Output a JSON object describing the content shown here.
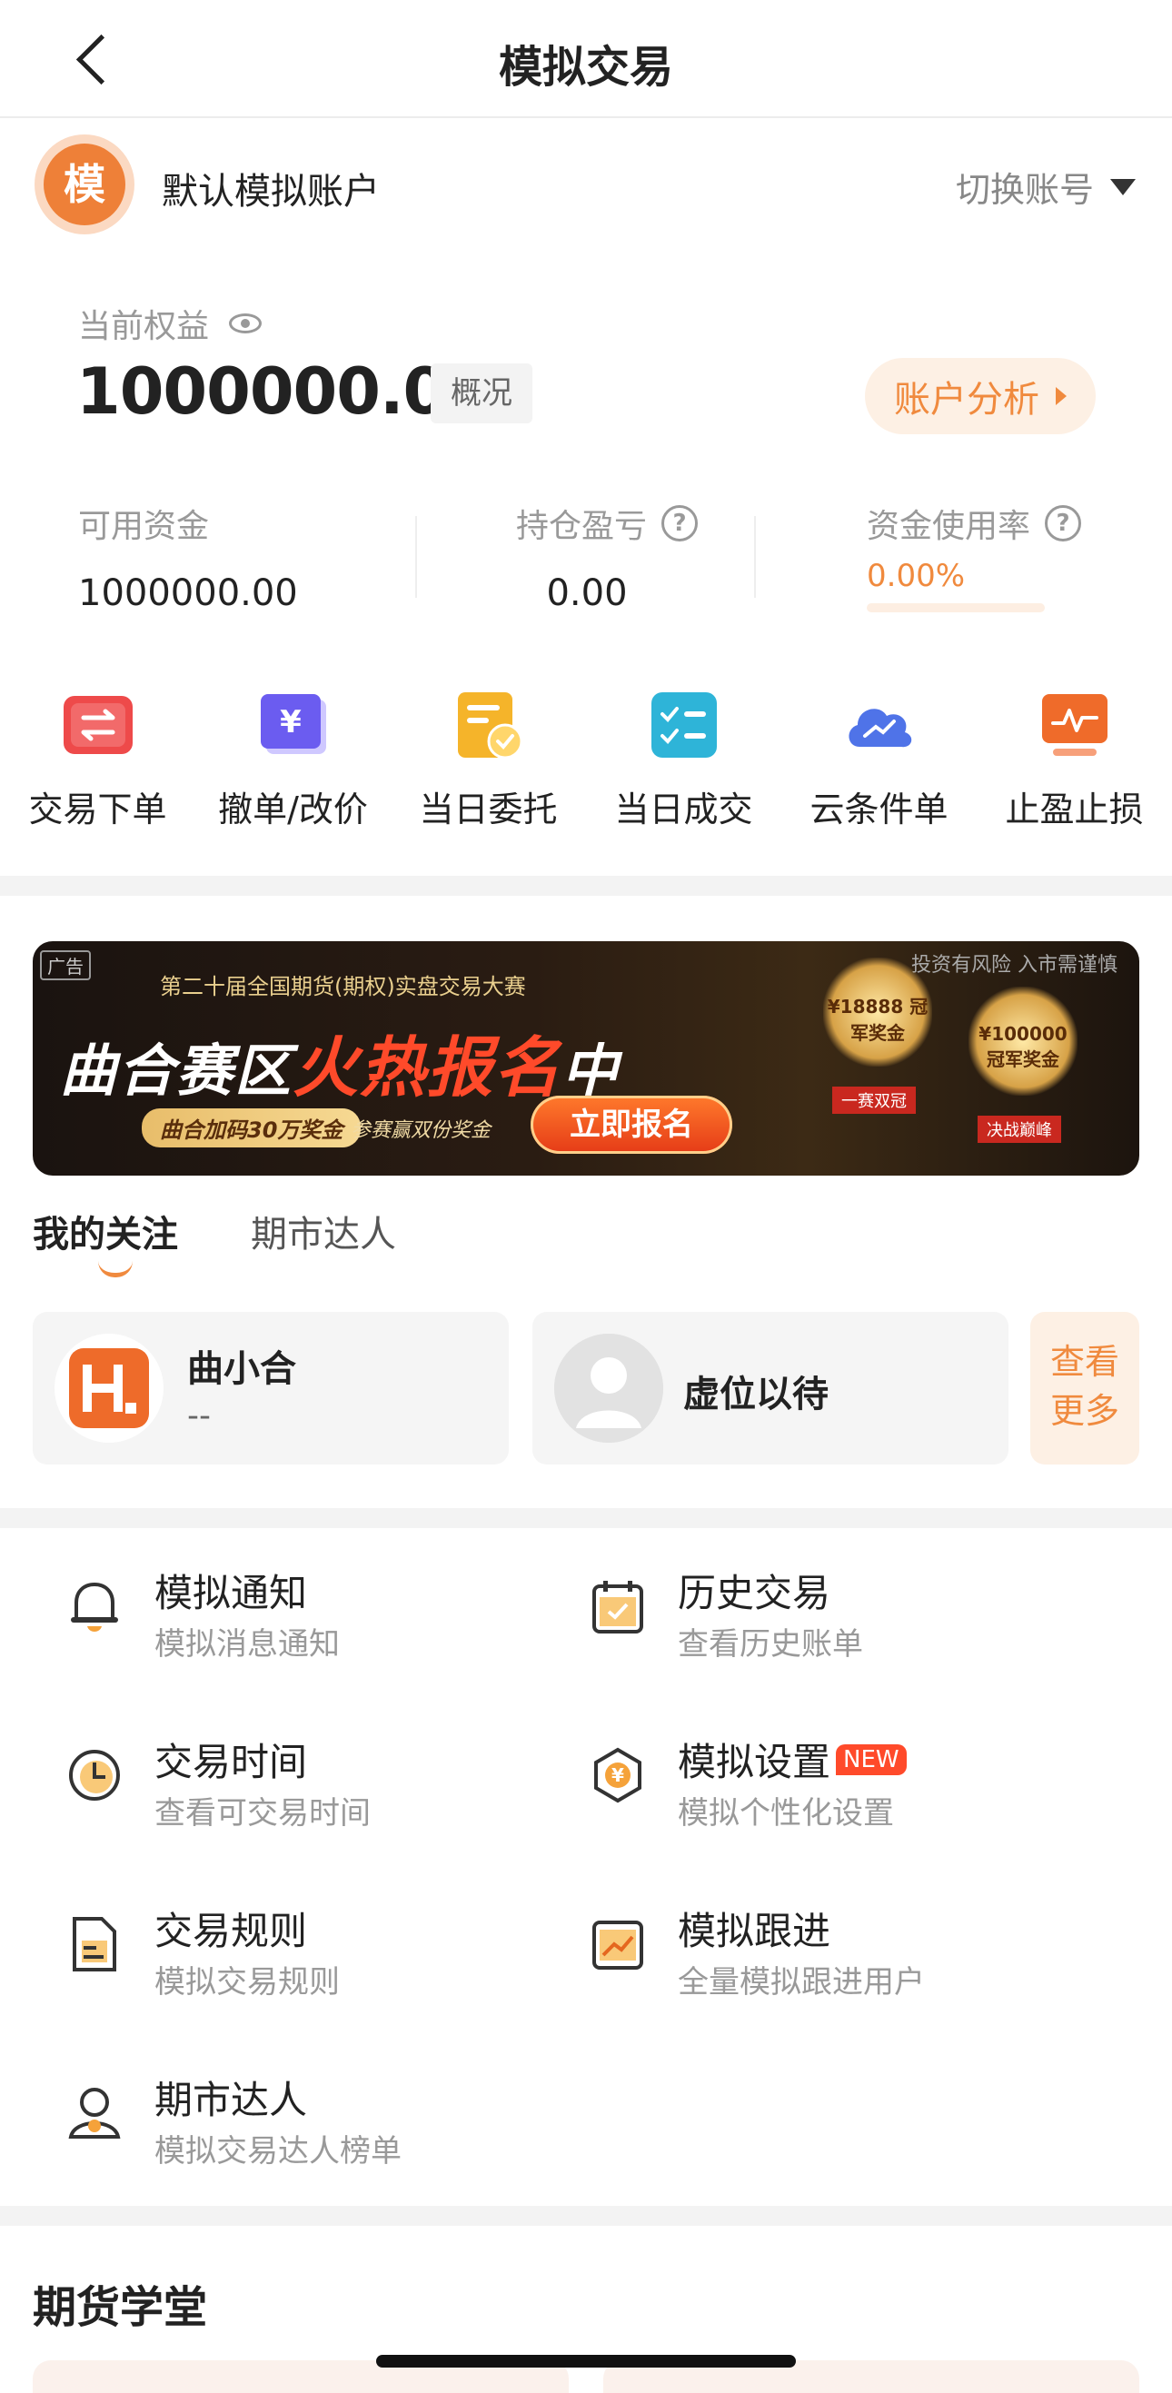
{
  "header": {
    "title": "模拟交易"
  },
  "account": {
    "avatar_char": "模",
    "name": "默认模拟账户",
    "switch_label": "切换账号"
  },
  "equity": {
    "label": "当前权益",
    "value": "1000000.00",
    "overview_label": "概况",
    "analysis_label": "账户分析"
  },
  "stats": {
    "available": {
      "label": "可用资金",
      "value": "1000000.00"
    },
    "pnl": {
      "label": "持仓盈亏",
      "value": "0.00"
    },
    "usage": {
      "label": "资金使用率",
      "value": "0.00%",
      "fraction": 0.0
    }
  },
  "quick_actions": [
    {
      "label": "交易下单",
      "icon": "exchange-icon"
    },
    {
      "label": "撤单/改价",
      "icon": "yen-ticket-icon"
    },
    {
      "label": "当日委托",
      "icon": "order-doc-icon"
    },
    {
      "label": "当日成交",
      "icon": "checklist-icon"
    },
    {
      "label": "云条件单",
      "icon": "cloud-chart-icon"
    },
    {
      "label": "止盈止损",
      "icon": "monitor-chart-icon"
    }
  ],
  "banner": {
    "ad_tag": "广告",
    "risk_note": "投资有风险 入市需谨慎",
    "subtitle": "第二十届全国期货(期权)实盘交易大赛",
    "title_prefix": "曲合赛区",
    "title_hot": "火热报名",
    "title_suffix": "中",
    "pill": "曲合加码30万奖金",
    "note": "参赛赢双份奖金",
    "signup": "立即报名",
    "prize1": "¥18888 冠军奖金",
    "prize2": "¥100000 冠军奖金",
    "plate1": "一赛双冠",
    "plate2": "决战巅峰"
  },
  "tabs": [
    {
      "label": "我的关注",
      "active": true
    },
    {
      "label": "期市达人",
      "active": false
    }
  ],
  "follows": [
    {
      "name": "曲小合",
      "sub": "--"
    },
    {
      "name": "虚位以待",
      "sub": ""
    }
  ],
  "more": {
    "line1": "查看",
    "line2": "更多"
  },
  "menu": [
    {
      "title": "模拟通知",
      "sub": "模拟消息通知",
      "icon": "bell-icon"
    },
    {
      "title": "历史交易",
      "sub": "查看历史账单",
      "icon": "calendar-icon"
    },
    {
      "title": "交易时间",
      "sub": "查看可交易时间",
      "icon": "clock-icon"
    },
    {
      "title": "模拟设置",
      "sub": "模拟个性化设置",
      "icon": "settings-hex-icon",
      "badge": "NEW"
    },
    {
      "title": "交易规则",
      "sub": "模拟交易规则",
      "icon": "rule-doc-icon"
    },
    {
      "title": "模拟跟进",
      "sub": "全量模拟跟进用户",
      "icon": "trend-icon"
    },
    {
      "title": "期市达人",
      "sub": "模拟交易达人榜单",
      "icon": "user-medal-icon"
    }
  ],
  "school": {
    "title": "期货学堂"
  },
  "colors": {
    "accent": "#f08a3e",
    "hot_red": "#ff4a2a",
    "divider": "#f3f3f3"
  }
}
